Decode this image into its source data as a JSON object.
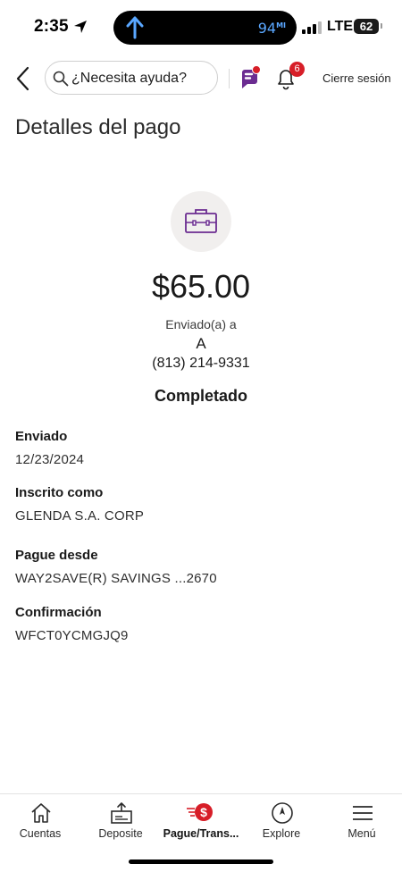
{
  "status_bar": {
    "time": "2:35",
    "island_text": "94",
    "island_unit": "MI",
    "network": "LTE",
    "battery": "62"
  },
  "header": {
    "search_placeholder": "¿Necesita ayuda?",
    "notification_count": "6",
    "logout_label": "Cierre sesión"
  },
  "page": {
    "title": "Detalles del pago"
  },
  "payment": {
    "amount": "$65.00",
    "sent_to_label": "Enviado(a) a",
    "recipient": "A",
    "phone": "(813) 214-9331",
    "status": "Completado"
  },
  "details": [
    {
      "label": "Enviado",
      "value": "12/23/2024"
    },
    {
      "label": "Inscrito como",
      "value": "GLENDA S.A. CORP"
    },
    {
      "label": "Pague desde",
      "value": "WAY2SAVE(R) SAVINGS ...2670"
    },
    {
      "label": "Confirmación",
      "value": "WFCT0YCMGJQ9"
    }
  ],
  "nav": [
    {
      "label": "Cuentas",
      "icon": "home-icon"
    },
    {
      "label": "Deposite",
      "icon": "deposit-icon"
    },
    {
      "label": "Pague/Trans...",
      "icon": "pay-transfer-icon"
    },
    {
      "label": "Explore",
      "icon": "compass-icon"
    },
    {
      "label": "Menú",
      "icon": "menu-icon"
    }
  ],
  "colors": {
    "brand_red": "#d71e28",
    "accent_purple": "#6b2c91",
    "island_blue": "#5aa7ff"
  }
}
